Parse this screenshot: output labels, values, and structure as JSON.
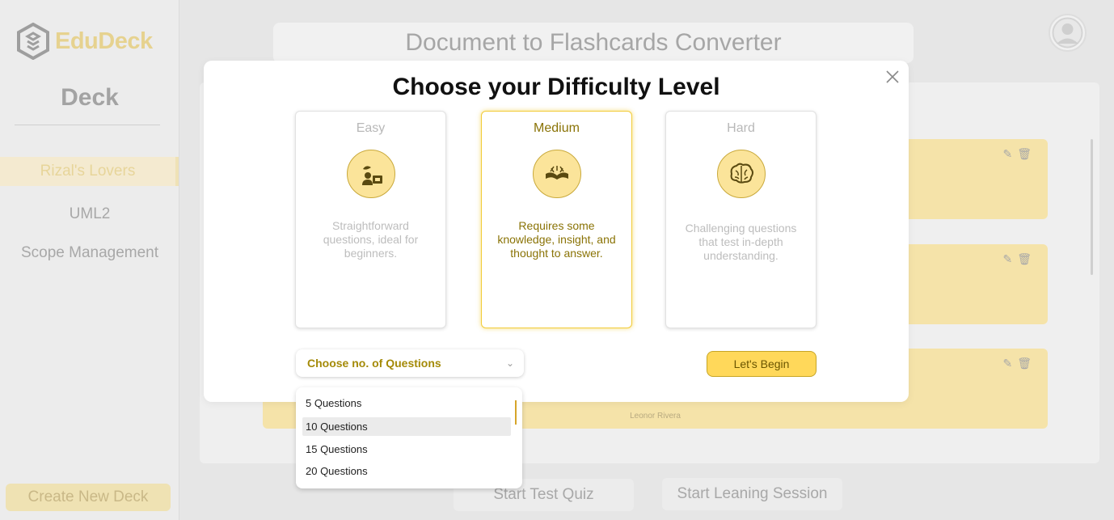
{
  "sidebar": {
    "logo_text": "EduDeck",
    "section_title": "Deck",
    "decks": [
      {
        "label": "Rizal's Lovers",
        "active": true
      },
      {
        "label": "UML2",
        "active": false
      },
      {
        "label": "Scope Management",
        "active": false
      }
    ],
    "create_button": "Create New Deck"
  },
  "header": {
    "title": "Document to Flashcards Converter"
  },
  "cards": [
    {
      "author": ""
    },
    {
      "author": ""
    },
    {
      "author": "Leonor Rivera"
    }
  ],
  "bottom": {
    "test_button": "Start Test Quiz",
    "learn_button": "Start Leaning Session"
  },
  "modal": {
    "title": "Choose your Difficulty Level",
    "difficulties": [
      {
        "name": "Easy",
        "icon": "leaf-book-icon",
        "description": "Straightforward questions, ideal for beginners.",
        "selected": false
      },
      {
        "name": "Medium",
        "icon": "open-book-icon",
        "description": "Requires some knowledge, insight, and thought to answer.",
        "selected": true
      },
      {
        "name": "Hard",
        "icon": "brain-icon",
        "description": "Challenging questions that test in-depth understanding.",
        "selected": false
      }
    ],
    "select_placeholder": "Choose no. of Questions",
    "begin_button": "Let's Begin"
  },
  "dropdown": {
    "options": [
      "5 Questions",
      "10 Questions",
      "15 Questions",
      "20 Questions"
    ],
    "hovered": "10 Questions"
  },
  "colors": {
    "accent": "#ffd85a",
    "accent_text": "#a48a08",
    "card_bg": "#f5e3a9"
  }
}
